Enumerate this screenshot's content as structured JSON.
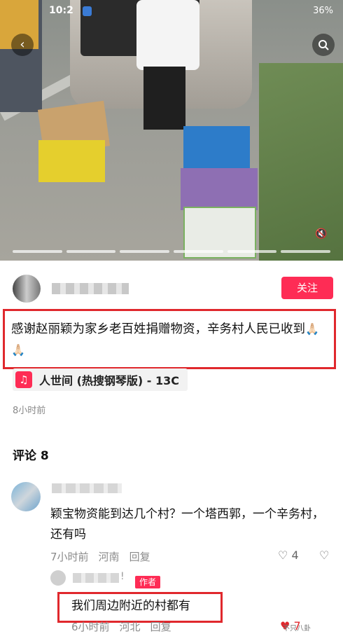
{
  "status_bar": {
    "time": "10:2",
    "battery": "36%"
  },
  "video": {
    "icons": [
      "back-icon",
      "search-icon",
      "mute-icon"
    ],
    "progress_segments": 6
  },
  "author": {
    "follow_label": "关注"
  },
  "post": {
    "caption": "感谢赵丽颖为家乡老百姓捐赠物资，辛务村人民已收到",
    "emoji": "🙏🏻🙏🏻",
    "music": "人世间 (热搜钢琴版) - 13C",
    "time_ago": "8小时前"
  },
  "comments": {
    "title": "评论 8",
    "items": [
      {
        "text": "颖宝物资能到达几个村？一个塔西郭，一个辛务村，还有吗",
        "time": "7小时前",
        "location": "河南",
        "reply_label": "回复",
        "likes": "4",
        "reply": {
          "bang": "!",
          "author_tag": "作者",
          "text": "我们周边附近的村都有",
          "time": "6小时前",
          "location": "河北",
          "reply_label": "回复",
          "likes": "7"
        }
      }
    ]
  },
  "watermark": "不只八卦",
  "colors": {
    "accent": "#fe2c55",
    "highlight_border": "#e0282d"
  }
}
